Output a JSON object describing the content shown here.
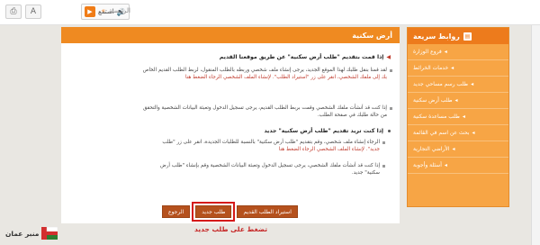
{
  "topbar": {
    "breadcrumb_home": "الرئيسية",
    "breadcrumb_sep": "»",
    "listen_label": "استمع",
    "print_icon": "print-icon"
  },
  "sidebar": {
    "title": "روابط سريعة",
    "items": [
      {
        "label": "فروع الوزارة"
      },
      {
        "label": "خدمات الخرائط"
      },
      {
        "label": "طلب رسم مساحي جديد"
      },
      {
        "label": "طلب أرض سكنية"
      },
      {
        "label": "طلب مساعدة سكنية"
      },
      {
        "label": "بحث عن اسم في القائمة"
      },
      {
        "label": "الأراضي التجارية"
      },
      {
        "label": "أسئلة وأجوبة"
      }
    ]
  },
  "main": {
    "title": "أرض سكنية",
    "q1": "إذا قمت بتقديم \"طلب أرض سكنية\" عن طريق موقعنا القديم",
    "p1_a": "لقد قمنا بنقل طلبك لهذا الموقع الجديد، يرجى إنشاء ملف شخصي وربطه بالطلب المنقول، لربط الطلب القديم الخاص",
    "p1_b": "بك إلى ملفك الشخصي، انقر على زر \"استيراد الطلب\". لإنشاء الملف الشخصي الرجاء الضغط هنا",
    "p2_a": "إذا كنت قد أنشأت ملفك الشخصي وقمت بربط الطلب القديم، يرجى تسجيل الدخول وتعبئة البيانات الشخصية والتحقق",
    "p2_b": "من حالة طلبك في صفحة الطلب.",
    "q2": "إذا كنت تريد تقديم \"طلب أرض سكنية\" جديد",
    "p3_a": "الرجاء إنشاء ملف شخصي، وقم بتقديم \"طلب أرض سكنية\" بالنسبة للطلبات الجديدة، انقر على زر \"طلب",
    "p3_b": "جديد\". لإنشاء الملف الشخصي الرجاء الضغط هنا",
    "p4_a": "إذا كنت قد أنشأت ملفك الشخصي، يرجى تسجيل الدخول وتعبئة البيانات الشخصية وقم بإنشاء \"طلب أرض",
    "p4_b": "سكنية\" جديد.",
    "buttons": {
      "import": "استيراد الطلب القديم",
      "new": "طلب جديد",
      "back": "الرجوع"
    }
  },
  "annotation": "تضغط على طلب جديد",
  "watermark": "منبر عمان"
}
